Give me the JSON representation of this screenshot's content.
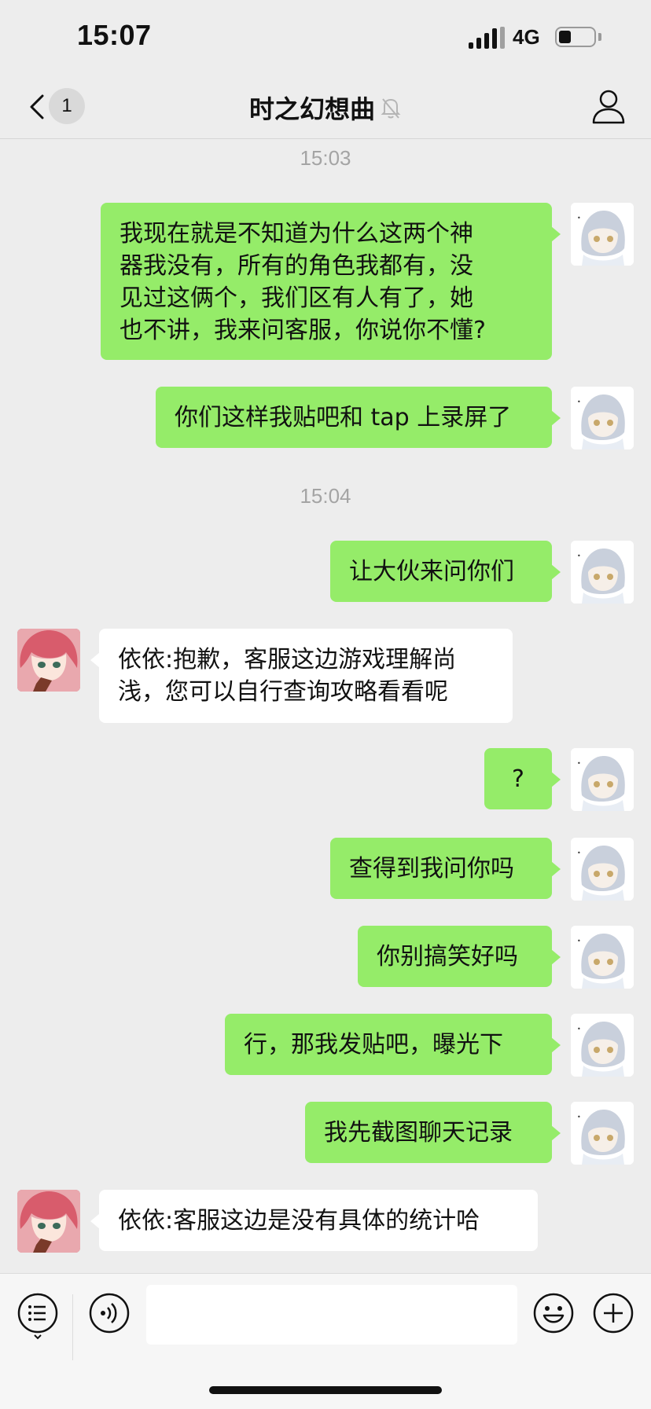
{
  "status_bar": {
    "time": "15:07",
    "network": "4G",
    "battery_level": 0.35
  },
  "header": {
    "back_badge": "1",
    "title": "时之幻想曲",
    "muted": true
  },
  "messages": [
    {
      "type": "time",
      "text": "15:03"
    },
    {
      "type": "msg",
      "sender": "me",
      "lines": [
        "我现在就是不知道为什么这两个神",
        "器我没有，所有的角色我都有，没",
        "见过这俩个，我们区有人有了，她",
        "也不讲，我来问客服，你说你不懂?"
      ]
    },
    {
      "type": "msg",
      "sender": "me",
      "lines": [
        "你们这样我贴吧和 tap 上录屏了"
      ]
    },
    {
      "type": "time",
      "text": "15:04"
    },
    {
      "type": "msg",
      "sender": "me",
      "lines": [
        "让大伙来问你们"
      ]
    },
    {
      "type": "msg",
      "sender": "cs",
      "lines": [
        "依依:抱歉，客服这边游戏理解尚",
        "浅，您可以自行查询攻略看看呢"
      ]
    },
    {
      "type": "msg",
      "sender": "me",
      "lines": [
        "?"
      ]
    },
    {
      "type": "msg",
      "sender": "me",
      "lines": [
        "查得到我问你吗"
      ]
    },
    {
      "type": "msg",
      "sender": "me",
      "lines": [
        "你别搞笑好吗"
      ]
    },
    {
      "type": "msg",
      "sender": "me",
      "lines": [
        "行，那我发贴吧，曝光下"
      ]
    },
    {
      "type": "msg",
      "sender": "me",
      "lines": [
        "我先截图聊天记录"
      ]
    },
    {
      "type": "msg",
      "sender": "cs",
      "lines": [
        "依依:客服这边是没有具体的统计哈"
      ]
    }
  ],
  "input_bar": {
    "placeholder": ""
  },
  "colors": {
    "background": "#ededed",
    "my_bubble": "#95ec69",
    "their_bubble": "#ffffff",
    "timestamp": "#a4a4a4"
  },
  "icons": {
    "back": "chevron-left-icon",
    "mute": "bell-slash-icon",
    "profile": "person-icon",
    "menu": "list-icon",
    "voice": "voice-icon",
    "emoji": "smile-icon",
    "add": "plus-circle-icon"
  }
}
